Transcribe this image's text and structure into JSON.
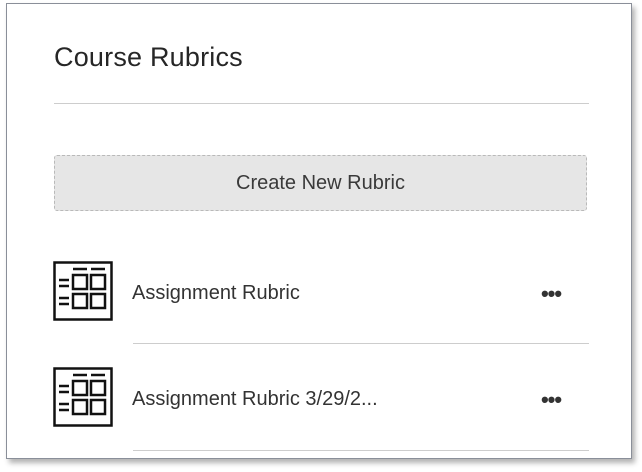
{
  "panel": {
    "title": "Course Rubrics",
    "create_button_label": "Create New Rubric"
  },
  "rubrics": [
    {
      "name": "Assignment Rubric",
      "icon": "rubric-grid-icon",
      "more_label": "•••"
    },
    {
      "name": "Assignment Rubric 3/29/2...",
      "icon": "rubric-grid-icon",
      "more_label": "•••"
    }
  ],
  "colors": {
    "text": "#262626",
    "button_bg": "#e6e6e6",
    "divider": "#cdcdcd"
  }
}
